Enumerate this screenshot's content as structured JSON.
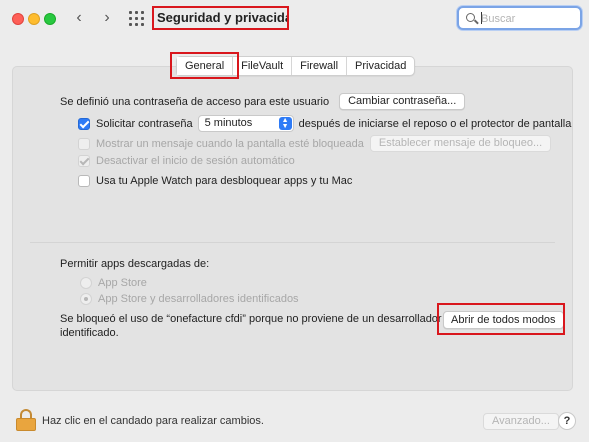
{
  "window": {
    "title": "Seguridad y privacidad"
  },
  "toolbar": {
    "back_glyph": "‹",
    "forward_glyph": "›",
    "search": {
      "placeholder": "Buscar",
      "value": ""
    }
  },
  "tabs": [
    {
      "label": "General",
      "selected": true
    },
    {
      "label": "FileVault",
      "selected": false
    },
    {
      "label": "Firewall",
      "selected": false
    },
    {
      "label": "Privacidad",
      "selected": false
    }
  ],
  "general": {
    "password_text": "Se definió una contraseña de acceso para este usuario",
    "change_password_button": "Cambiar contraseña...",
    "require_password": {
      "label": "Solicitar contraseña",
      "checked": true,
      "select_value": "5 minutos",
      "suffix": "después de iniciarse el reposo o el protector de pantalla"
    },
    "show_message": {
      "label": "Mostrar un mensaje cuando la pantalla esté bloqueada",
      "checked": false,
      "enabled": false,
      "button": "Establecer mensaje de bloqueo..."
    },
    "disable_auto_login": {
      "label": "Desactivar el inicio de sesión automático",
      "checked": true,
      "enabled": false
    },
    "apple_watch": {
      "label": "Usa tu Apple Watch para desbloquear apps y tu Mac",
      "checked": false
    },
    "allow_apps_label": "Permitir apps descargadas de:",
    "allow_options": [
      {
        "label": "App Store",
        "selected": false
      },
      {
        "label": "App Store y desarrolladores identificados",
        "selected": true
      }
    ],
    "blocked_message_line1": "Se bloqueó el uso de “onefacture cfdi” porque no proviene de un desarrollador",
    "blocked_message_line2": "identificado.",
    "open_anyway_button": "Abrir de todos modos"
  },
  "footer": {
    "lock_text": "Haz clic en el candado para realizar cambios.",
    "advanced_button": "Avanzado...",
    "help_button": "?"
  },
  "colors": {
    "accent": "#2e7bf6",
    "highlight": "#d9171d"
  }
}
